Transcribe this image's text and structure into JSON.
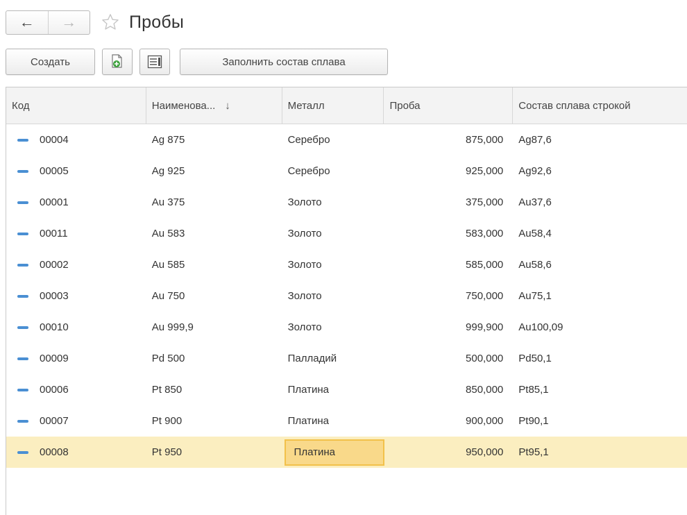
{
  "header": {
    "title": "Пробы",
    "back_icon": "arrow-left-icon",
    "forward_icon": "arrow-right-icon",
    "favorite_icon": "star-outline-icon"
  },
  "toolbar": {
    "create_label": "Создать",
    "copy_icon": "create-copy-icon",
    "list_settings_icon": "list-settings-icon",
    "fill_alloy_label": "Заполнить состав сплава"
  },
  "table": {
    "columns": [
      "Код",
      "Наименова...",
      "Металл",
      "Проба",
      "Состав сплава строкой"
    ],
    "sort_indicator": "↓",
    "rows": [
      {
        "code": "00004",
        "name": "Ag 875",
        "metal": "Серебро",
        "proba": "875,000",
        "composition": "Ag87,6"
      },
      {
        "code": "00005",
        "name": "Ag 925",
        "metal": "Серебро",
        "proba": "925,000",
        "composition": "Ag92,6"
      },
      {
        "code": "00001",
        "name": "Au 375",
        "metal": "Золото",
        "proba": "375,000",
        "composition": "Au37,6"
      },
      {
        "code": "00011",
        "name": "Au 583",
        "metal": "Золото",
        "proba": "583,000",
        "composition": "Au58,4"
      },
      {
        "code": "00002",
        "name": "Au 585",
        "metal": "Золото",
        "proba": "585,000",
        "composition": "Au58,6"
      },
      {
        "code": "00003",
        "name": "Au 750",
        "metal": "Золото",
        "proba": "750,000",
        "composition": "Au75,1"
      },
      {
        "code": "00010",
        "name": "Au 999,9",
        "metal": "Золото",
        "proba": "999,900",
        "composition": "Au100,09"
      },
      {
        "code": "00009",
        "name": "Pd 500",
        "metal": "Палладий",
        "proba": "500,000",
        "composition": "Pd50,1"
      },
      {
        "code": "00006",
        "name": "Pt 850",
        "metal": "Платина",
        "proba": "850,000",
        "composition": "Pt85,1"
      },
      {
        "code": "00007",
        "name": "Pt 900",
        "metal": "Платина",
        "proba": "900,000",
        "composition": "Pt90,1"
      },
      {
        "code": "00008",
        "name": "Pt 950",
        "metal": "Платина",
        "proba": "950,000",
        "composition": "Pt95,1"
      }
    ],
    "selected_row_index": 10,
    "row_icon": "catalog-item-dash-icon"
  },
  "colors": {
    "selected_row": "#fbeec0",
    "focused_cell": "#f9d98a",
    "row_icon": "#4a8fd3"
  }
}
